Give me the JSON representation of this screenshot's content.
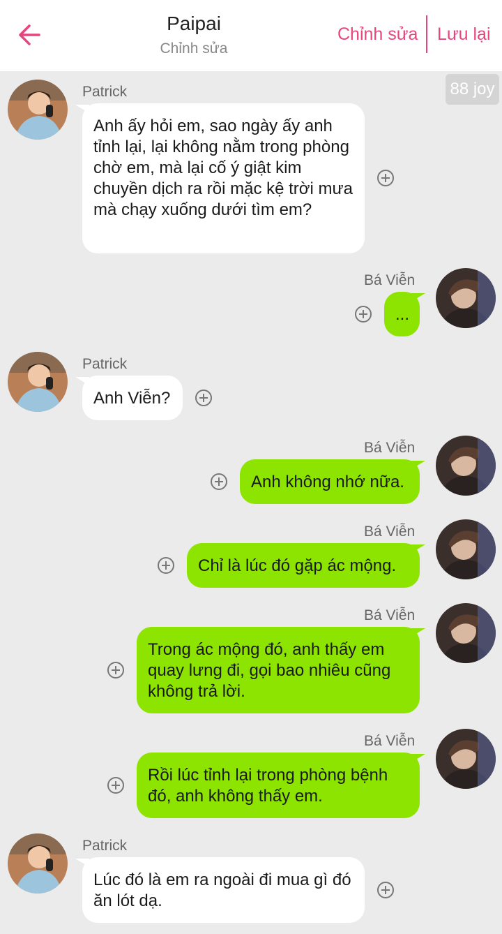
{
  "header": {
    "title": "Paipai",
    "subtitle": "Chỉnh sửa",
    "edit_label": "Chỉnh sửa",
    "save_label": "Lưu lại",
    "accent": "#e8447e"
  },
  "badge": {
    "text": "88 joy"
  },
  "colors": {
    "background": "#ebebeb",
    "incoming_bubble": "#ffffff",
    "outgoing_bubble": "#8ce400"
  },
  "messages": [
    {
      "sender": "Patrick",
      "side": "left",
      "text": "Anh ấy hỏi em, sao ngày ấy anh tỉnh lại, lại không nằm trong phòng chờ em, mà lại cố ý giật kim chuyền dịch ra rồi mặc kệ trời mưa mà chạy xuống dưới tìm em?"
    },
    {
      "sender": "Bá Viễn",
      "side": "right",
      "text": "..."
    },
    {
      "sender": "Patrick",
      "side": "left",
      "text": "Anh Viễn?"
    },
    {
      "sender": "Bá Viễn",
      "side": "right",
      "text": "Anh không nhớ nữa."
    },
    {
      "sender": "Bá Viễn",
      "side": "right",
      "text": "Chỉ là lúc đó gặp ác mộng."
    },
    {
      "sender": "Bá Viễn",
      "side": "right",
      "text": "Trong ác mộng đó, anh thấy em quay lưng đi, gọi bao nhiêu cũng không trả lời."
    },
    {
      "sender": "Bá Viễn",
      "side": "right",
      "text": "Rồi lúc tỉnh lại trong phòng bệnh đó, anh không thấy em."
    },
    {
      "sender": "Patrick",
      "side": "left",
      "text": "Lúc đó là em ra ngoài đi mua gì đó ăn lót dạ."
    }
  ]
}
